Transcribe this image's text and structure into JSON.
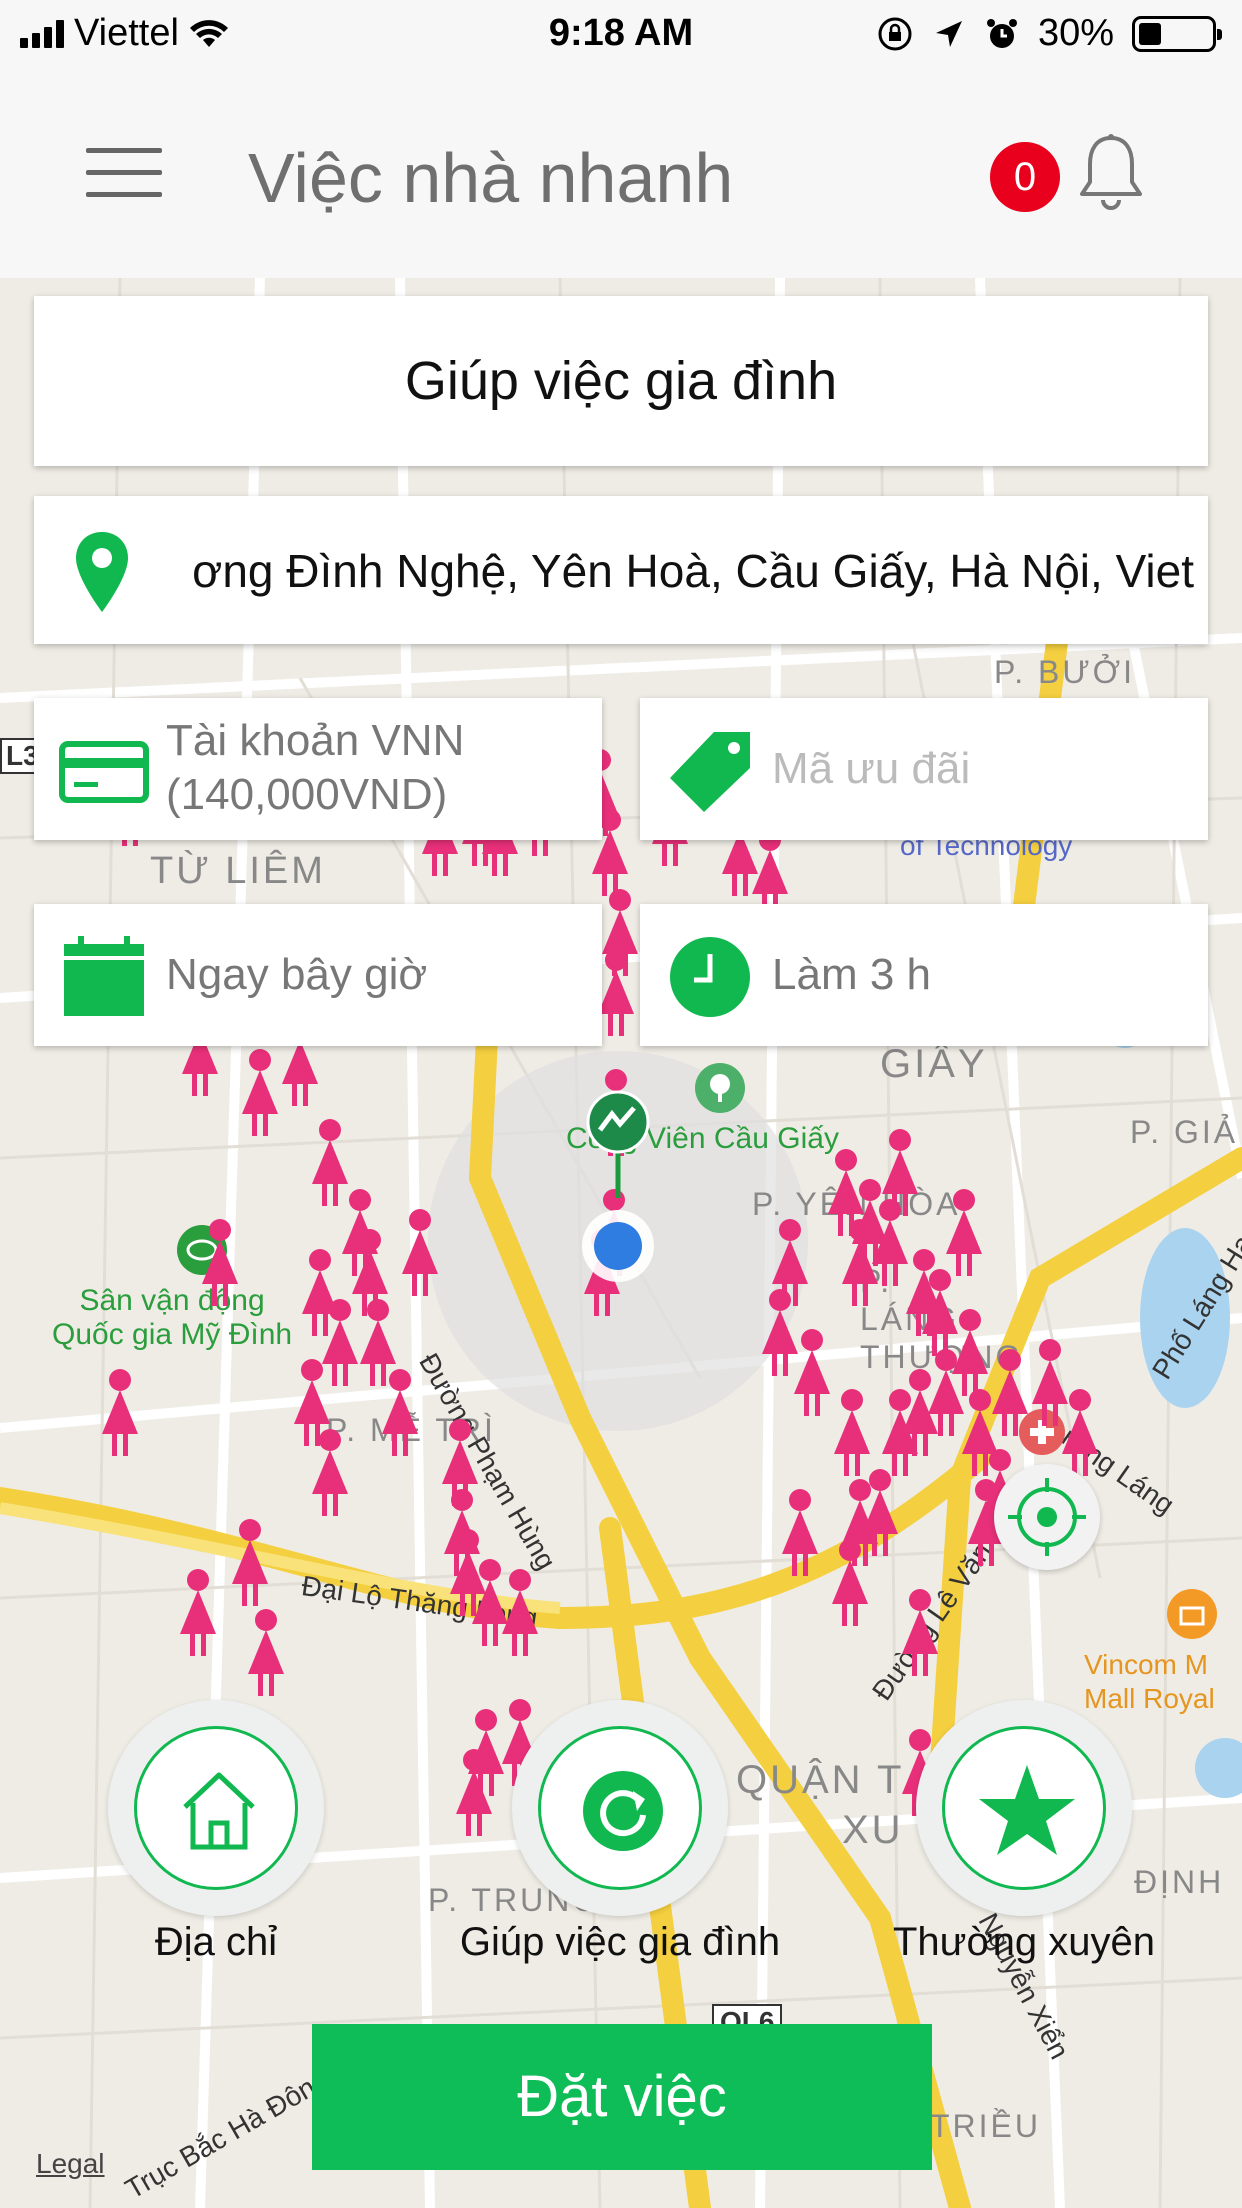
{
  "status_bar": {
    "carrier": "Viettel",
    "time": "9:18 AM",
    "battery": "30%"
  },
  "header": {
    "title": "Việc nhà nhanh",
    "notification_count": "0"
  },
  "service": {
    "title": "Giúp việc gia đình"
  },
  "address": {
    "value": "Lương Đình Nghệ, Yên Hoà, Cầu Giấy, Hà Nội, Viet"
  },
  "payment": {
    "line1": "Tài khoản VNN",
    "line2": "(140,000VND)"
  },
  "promo": {
    "placeholder": "Mã ưu đãi"
  },
  "schedule": {
    "time_label": "Ngay bây giờ",
    "duration_label": "Làm 3 h"
  },
  "map": {
    "labels": {
      "district_tu_liem": "TỪ LIÊM",
      "p_buoi": "P. BƯỞI",
      "technology": "of Technology",
      "giay": "GIẤY",
      "p_giang": "P. GIẢ",
      "park": "Công Viên Cầu Giấy",
      "p_yen_hoa": "P. YÊN HÒA",
      "p_lang_thuong": "P. LÁNG THƯỢNG",
      "stadium_line1": "Sân vận động",
      "stadium_line2": "Quốc gia Mỹ Đình",
      "p_me_tri": "P. MỄ TRÌ",
      "road_pham_hung": "Đường Phạm Hùng",
      "road_lang": "Đường Láng",
      "road_thang_long": "Đại Lộ Thăng Long",
      "road_le_van": "Đường Lê Văn",
      "road_lang_ha": "Phố Láng Hạ",
      "vincom_line1": "Vincom M",
      "vincom_line2": "Mall Royal",
      "quan_thanh_xuan": "QUẬN T",
      "xu": "XU",
      "p_trung": "P. TRUNG",
      "dinh": "ĐỊNH",
      "trieu": "TRIỀU",
      "road_nguyen_xien": "Nguyễn Xiển",
      "road_ha_dong": "Trục Bắc Hà Đông",
      "ql6": "QL6",
      "l3": "L3",
      "legal": "Legal"
    }
  },
  "actions": [
    {
      "label": "Địa chỉ",
      "icon": "home-icon"
    },
    {
      "label": "Giúp việc gia đình",
      "icon": "refresh-icon"
    },
    {
      "label": "Thường xuyên",
      "icon": "star-icon"
    }
  ],
  "book_button": {
    "label": "Đặt việc"
  },
  "colors": {
    "accent_green": "#0fbd58",
    "marker_pink": "#e8307a",
    "badge_red": "#e8001c"
  }
}
